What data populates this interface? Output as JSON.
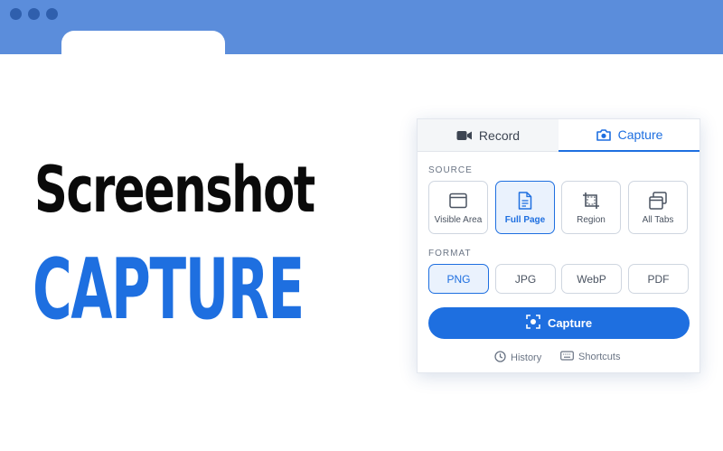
{
  "hero": {
    "line1": "Screenshot",
    "line2": "CAPTURE"
  },
  "popup": {
    "tabs": [
      {
        "label": "Record",
        "icon": "video-camera-icon",
        "active": false
      },
      {
        "label": "Capture",
        "icon": "camera-icon",
        "active": true
      }
    ],
    "source_label": "SOURCE",
    "sources": [
      {
        "label": "Visible Area",
        "icon": "browser-window-icon",
        "active": false
      },
      {
        "label": "Full Page",
        "icon": "document-icon",
        "active": true
      },
      {
        "label": "Region",
        "icon": "crop-region-icon",
        "active": false
      },
      {
        "label": "All Tabs",
        "icon": "stacked-tabs-icon",
        "active": false
      }
    ],
    "format_label": "FORMAT",
    "formats": [
      {
        "label": "PNG",
        "active": true
      },
      {
        "label": "JPG",
        "active": false
      },
      {
        "label": "WebP",
        "active": false
      },
      {
        "label": "PDF",
        "active": false
      }
    ],
    "capture_button": "Capture",
    "footer": {
      "history": "History",
      "shortcuts": "Shortcuts"
    }
  },
  "colors": {
    "accent": "#1e6fe0",
    "chrome_bar": "#5b8ddb",
    "chrome_dots": "#2f5fad"
  }
}
